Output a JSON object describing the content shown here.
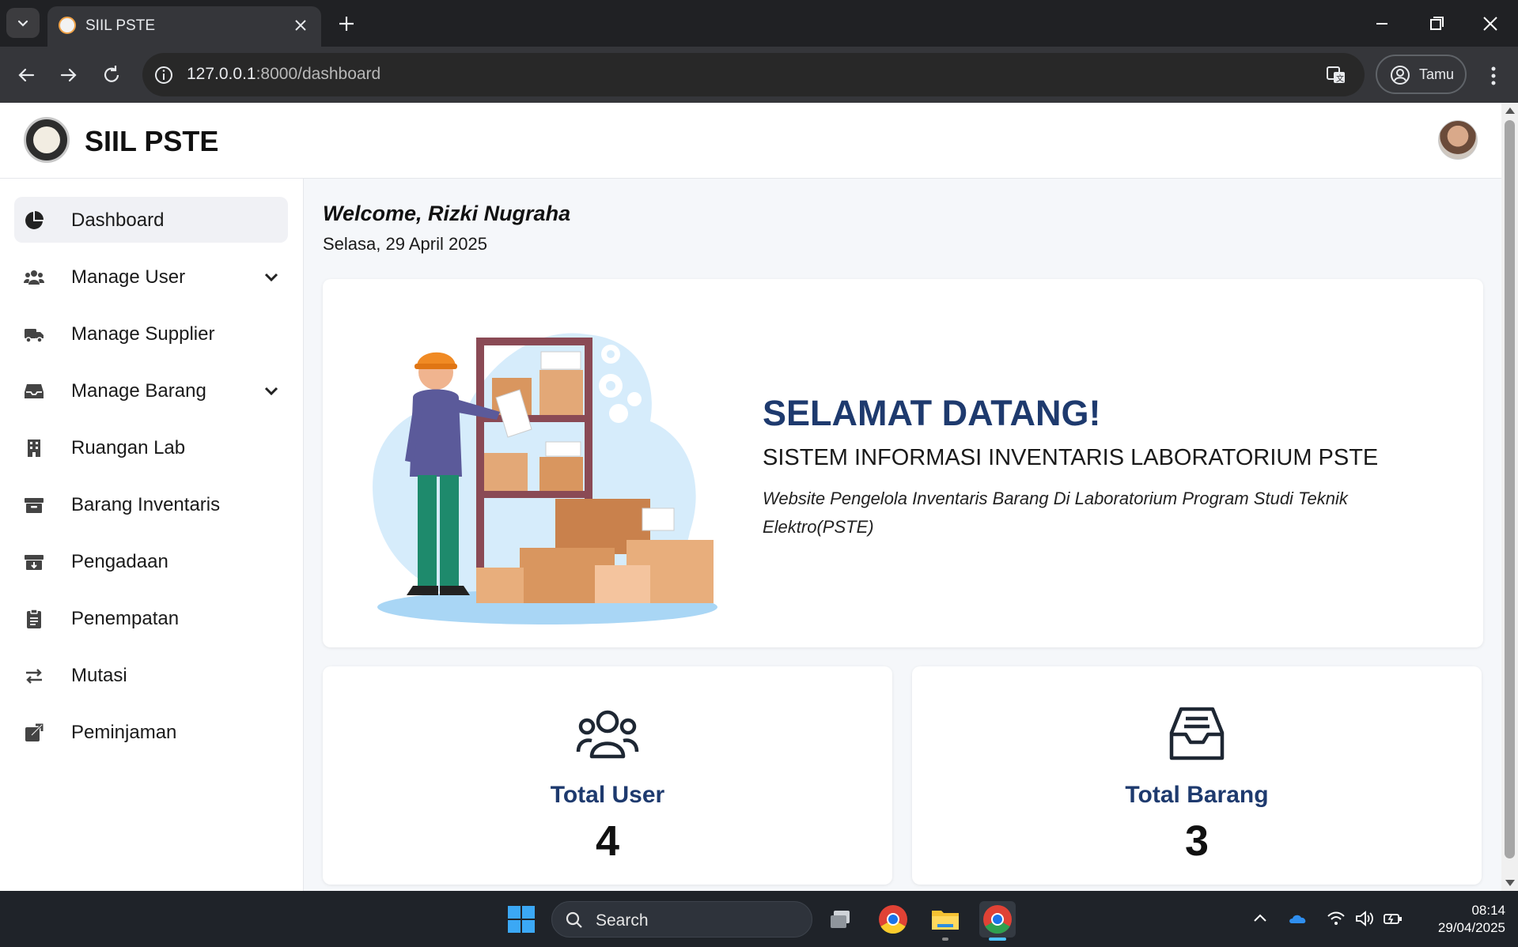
{
  "browser": {
    "tab_title": "SIIL PSTE",
    "url_host": "127.0.0.1",
    "url_path": ":8000/dashboard",
    "profile_label": "Tamu"
  },
  "app": {
    "brand": "SIIL PSTE"
  },
  "sidebar": {
    "items": [
      {
        "label": "Dashboard",
        "icon": "chart-pie-icon",
        "active": true
      },
      {
        "label": "Manage User",
        "icon": "users-icon",
        "has_submenu": true
      },
      {
        "label": "Manage Supplier",
        "icon": "truck-icon"
      },
      {
        "label": "Manage Barang",
        "icon": "inbox-icon",
        "has_submenu": true
      },
      {
        "label": "Ruangan Lab",
        "icon": "building-icon"
      },
      {
        "label": "Barang Inventaris",
        "icon": "archive-icon"
      },
      {
        "label": "Pengadaan",
        "icon": "archive-down-icon"
      },
      {
        "label": "Penempatan",
        "icon": "clipboard-icon"
      },
      {
        "label": "Mutasi",
        "icon": "arrows-swap-icon"
      },
      {
        "label": "Peminjaman",
        "icon": "external-link-icon"
      }
    ]
  },
  "main": {
    "welcome": "Welcome, Rizki Nugraha",
    "date": "Selasa, 29 April 2025",
    "hero": {
      "title": "SELAMAT DATANG!",
      "subtitle": "SISTEM INFORMASI INVENTARIS LABORATORIUM PSTE",
      "description": "Website Pengelola Inventaris Barang Di Laboratorium Program Studi Teknik Elektro(PSTE)"
    },
    "stats": [
      {
        "label": "Total User",
        "value": "4",
        "icon": "users-outline-icon"
      },
      {
        "label": "Total Barang",
        "value": "3",
        "icon": "inbox-outline-icon"
      }
    ]
  },
  "taskbar": {
    "search_placeholder": "Search",
    "time": "08:14",
    "date": "29/04/2025"
  },
  "colors": {
    "accent": "#1e3a6e",
    "active_nav_bg": "#f0f1f5"
  }
}
